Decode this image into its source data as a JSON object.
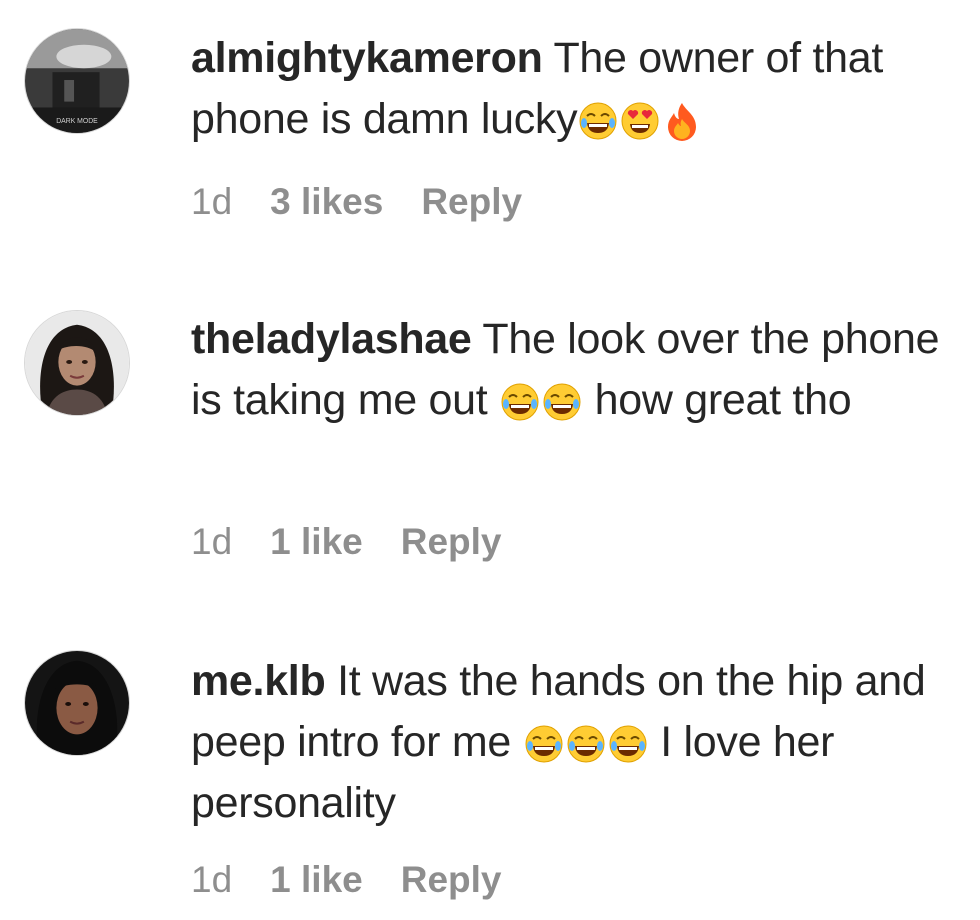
{
  "comments": [
    {
      "username": "almightykameron",
      "text_before": "The owner of that phone is damn lucky",
      "text_after": "",
      "avatar_caption": "DARK MODE",
      "time": "1d",
      "likes": "3 likes",
      "reply": "Reply"
    },
    {
      "username": "theladylashae",
      "text_before": "The look over the phone is taking me out ",
      "text_after": " how great tho",
      "time": "1d",
      "likes": "1 like",
      "reply": "Reply"
    },
    {
      "username": "me.klb",
      "text_before": "It was the hands on the hip and peep intro for me ",
      "text_after": " I love her personality",
      "time": "1d",
      "likes": "1 like",
      "reply": "Reply"
    }
  ],
  "emoji_names": {
    "joy": "face-with-tears-of-joy-icon",
    "heart_eyes": "smiling-face-with-heart-eyes-icon",
    "fire": "fire-icon"
  },
  "colors": {
    "text": "#262626",
    "meta": "#8e8e8e",
    "emoji_yellow": "#ffcc33",
    "fire_orange": "#ff5a1f"
  }
}
